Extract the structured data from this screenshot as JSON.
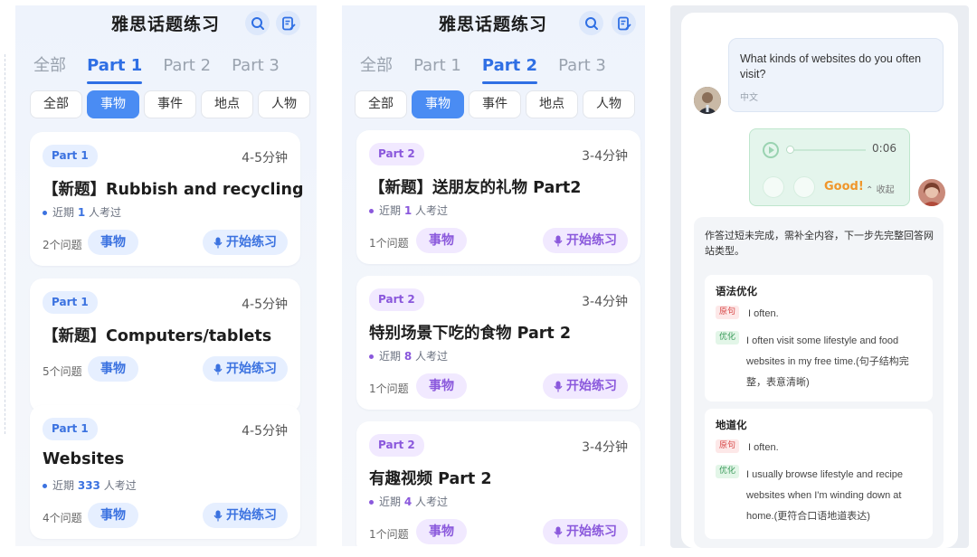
{
  "colors": {
    "accent_blue": "#2f6fe4",
    "chip_active": "#4a8cf3",
    "purple": "#8a58dc",
    "good_orange": "#f0962a",
    "answer_green": "#e4f5ec"
  },
  "screen1": {
    "title": "雅思话题练习",
    "icons": [
      "search-icon",
      "notes-icon"
    ],
    "tabs": [
      "全部",
      "Part 1",
      "Part 2",
      "Part 3"
    ],
    "active_tab": "Part 1",
    "chips": [
      "全部",
      "事物",
      "事件",
      "地点",
      "人物"
    ],
    "active_chip": "事物",
    "cards": [
      {
        "tag": "Part 1",
        "duration": "4-5分钟",
        "title": "【新题】Rubbish and recycling",
        "recent_prefix": "近期",
        "recent_count": "1",
        "recent_suffix": "人考过",
        "questions": "2个问题",
        "type": "事物",
        "practice": "开始练习"
      },
      {
        "tag": "Part 1",
        "duration": "4-5分钟",
        "title": "【新题】Computers/tablets",
        "questions": "5个问题",
        "type": "事物",
        "practice": "开始练习"
      },
      {
        "tag": "Part 1",
        "duration": "4-5分钟",
        "title": "Websites",
        "recent_prefix": "近期",
        "recent_count": "333",
        "recent_suffix": "人考过",
        "questions": "4个问题",
        "type": "事物",
        "practice": "开始练习"
      }
    ]
  },
  "screen2": {
    "title": "雅思话题练习",
    "icons": [
      "search-icon",
      "notes-icon"
    ],
    "tabs": [
      "全部",
      "Part 1",
      "Part 2",
      "Part 3"
    ],
    "active_tab": "Part 2",
    "chips": [
      "全部",
      "事物",
      "事件",
      "地点",
      "人物"
    ],
    "active_chip": "事物",
    "cards": [
      {
        "tag": "Part 2",
        "duration": "3-4分钟",
        "title": "【新题】送朋友的礼物 Part2",
        "recent_prefix": "近期",
        "recent_count": "1",
        "recent_suffix": "人考过",
        "questions": "1个问题",
        "type": "事物",
        "practice": "开始练习"
      },
      {
        "tag": "Part 2",
        "duration": "3-4分钟",
        "title": "特别场景下吃的食物 Part 2",
        "recent_prefix": "近期",
        "recent_count": "8",
        "recent_suffix": "人考过",
        "questions": "1个问题",
        "type": "事物",
        "practice": "开始练习"
      },
      {
        "tag": "Part 2",
        "duration": "3-4分钟",
        "title": "有趣视频 Part 2",
        "recent_prefix": "近期",
        "recent_count": "4",
        "recent_suffix": "人考过",
        "questions": "1个问题",
        "type": "事物",
        "practice": "开始练习"
      }
    ]
  },
  "screen3": {
    "question": "What kinds of websites do you often visit?",
    "question_lang": "中文",
    "audio_time": "0:06",
    "rating": "Good!",
    "collapse": "收起",
    "feedback_intro": "作答过短未完成，需补全内容，下一步先完整回答网站类型。",
    "sections": [
      {
        "title": "语法优化",
        "orig_label": "原句",
        "orig": "I often.",
        "opt_label": "优化",
        "opt": "I often visit some lifestyle and food websites in my free time.(句子结构完整，表意清晰)"
      },
      {
        "title": "地道化",
        "orig_label": "原句",
        "orig": "I often.",
        "opt_label": "优化",
        "opt": "I usually browse lifestyle and recipe websites when I'm winding down at home.(更符合口语地道表达)"
      }
    ]
  }
}
